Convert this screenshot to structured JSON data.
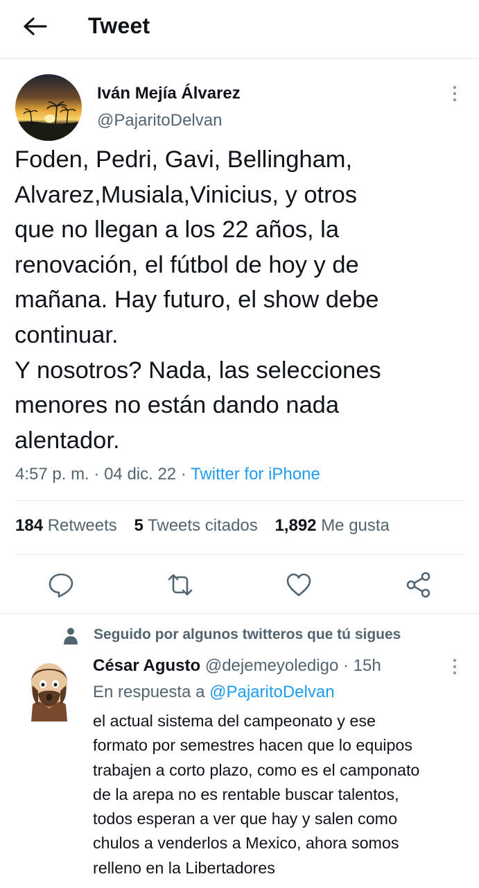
{
  "header": {
    "title": "Tweet",
    "back_icon": "arrow-left-icon"
  },
  "tweet": {
    "author_name": "Iván Mejía Álvarez",
    "author_handle": "@PajaritoDelvan",
    "text": "Foden, Pedri, Gavi, Bellingham,\nAlvarez,Musiala,Vinicius, y otros\nque no llegan a los 22 años, la\nrenovación, el fútbol de hoy y de\nmañana. Hay futuro, el show debe\ncontinuar.\nY nosotros? Nada, las selecciones\nmenores no están dando nada\nalentador.",
    "time": "4:57 p. m.",
    "sep": "·",
    "date": "04 dic. 22",
    "source": "Twitter for iPhone",
    "stats": {
      "retweets_count": "184",
      "retweets_label": "Retweets",
      "quotes_count": "5",
      "quotes_label": "Tweets citados",
      "likes_count": "1,892",
      "likes_label": "Me gusta"
    },
    "actions": [
      "reply-icon",
      "retweet-icon",
      "like-icon",
      "share-icon"
    ]
  },
  "reply_section": {
    "social_context": "Seguido por algunos twitteros que tú sigues",
    "reply": {
      "author_name": "César Agusto",
      "author_handle": "@dejemeyoledigo",
      "sep": "·",
      "time": "15h",
      "replying_prefix": "En respuesta a",
      "replying_handle": "@PajaritoDelvan",
      "text": "el actual sistema del campeonato y ese\nformato por semestres hacen que lo equipos\ntrabajen a corto plazo, como es el camponato\nde la arepa no es rentable buscar talentos,\ntodos esperan a ver que hay y salen como\nchulos a venderlos a Mexico, ahora somos\nrelleno en la Libertadores"
    }
  },
  "colors": {
    "accent": "#1d9bf0",
    "secondary_text": "#536471",
    "text": "#0f1419",
    "divider": "#e6ecf0"
  }
}
